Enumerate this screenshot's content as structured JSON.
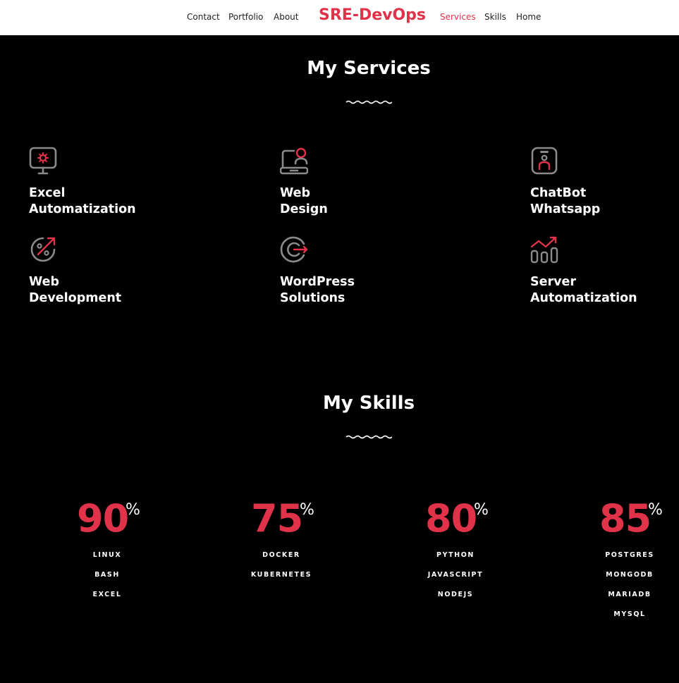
{
  "nav": {
    "left": [
      {
        "label": "Contact"
      },
      {
        "label": "Portfolio"
      },
      {
        "label": "About"
      }
    ],
    "brand": "SRE-DevOps",
    "right": [
      {
        "label": "Services",
        "active": true
      },
      {
        "label": "Skills"
      },
      {
        "label": "Home"
      }
    ]
  },
  "services": {
    "title": "My Services",
    "items": [
      {
        "line1": "Excel",
        "line2": "Automatization",
        "icon": "monitor-gear-icon"
      },
      {
        "line1": "Web",
        "line2": "Design",
        "icon": "laptop-user-icon"
      },
      {
        "line1": "ChatBot",
        "line2": "Whatsapp",
        "icon": "phone-user-icon"
      },
      {
        "line1": "Web",
        "line2": "Development",
        "icon": "discount-tag-icon"
      },
      {
        "line1": "WordPress",
        "line2": "Solutions",
        "icon": "wordpress-target-icon"
      },
      {
        "line1": "Server",
        "line2": "Automatization",
        "icon": "bar-chart-trend-icon"
      }
    ]
  },
  "skills": {
    "title": "My Skills",
    "groups": [
      {
        "percent": "90",
        "sign": "%",
        "items": [
          "LINUX",
          "BASH",
          "EXCEL"
        ]
      },
      {
        "percent": "75",
        "sign": "%",
        "items": [
          "DOCKER",
          "KUBERNETES"
        ]
      },
      {
        "percent": "80",
        "sign": "%",
        "items": [
          "PYTHON",
          "JAVASCRIPT",
          "NODEJS"
        ]
      },
      {
        "percent": "85",
        "sign": "%",
        "items": [
          "POSTGRES",
          "MONGODB",
          "MARIADB",
          "MYSQL"
        ]
      }
    ]
  },
  "colors": {
    "accent": "#e0334a",
    "background": "#000000",
    "navbar": "#ffffff",
    "icon_gray": "#8a8a8a"
  }
}
